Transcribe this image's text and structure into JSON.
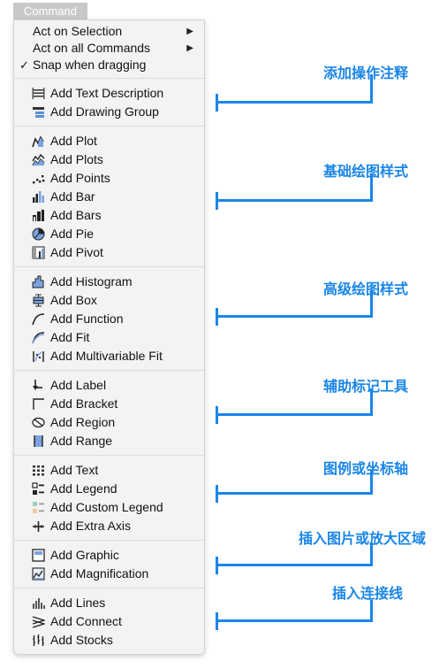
{
  "menu_title": "Command",
  "top_items": [
    {
      "label": "Act on Selection",
      "submenu": true,
      "checked": false
    },
    {
      "label": "Act on all Commands",
      "submenu": true,
      "checked": false
    },
    {
      "label": "Snap when dragging",
      "submenu": false,
      "checked": true
    }
  ],
  "check_glyph": "✓",
  "submenu_glyph": "▶",
  "groups": [
    {
      "items": [
        {
          "label": "Add Text Description",
          "icon": "text-description-icon"
        },
        {
          "label": "Add Drawing Group",
          "icon": "drawing-group-icon"
        }
      ]
    },
    {
      "items": [
        {
          "label": "Add Plot",
          "icon": "plot-icon"
        },
        {
          "label": "Add Plots",
          "icon": "plots-icon"
        },
        {
          "label": "Add Points",
          "icon": "points-icon"
        },
        {
          "label": "Add Bar",
          "icon": "bar-icon"
        },
        {
          "label": "Add Bars",
          "icon": "bars-icon"
        },
        {
          "label": "Add Pie",
          "icon": "pie-icon"
        },
        {
          "label": "Add Pivot",
          "icon": "pivot-icon"
        }
      ]
    },
    {
      "items": [
        {
          "label": "Add Histogram",
          "icon": "histogram-icon"
        },
        {
          "label": "Add Box",
          "icon": "box-icon"
        },
        {
          "label": "Add Function",
          "icon": "function-icon"
        },
        {
          "label": "Add Fit",
          "icon": "fit-icon"
        },
        {
          "label": "Add Multivariable Fit",
          "icon": "multivariable-fit-icon"
        }
      ]
    },
    {
      "items": [
        {
          "label": "Add Label",
          "icon": "label-icon"
        },
        {
          "label": "Add Bracket",
          "icon": "bracket-icon"
        },
        {
          "label": "Add Region",
          "icon": "region-icon"
        },
        {
          "label": "Add Range",
          "icon": "range-icon"
        }
      ]
    },
    {
      "items": [
        {
          "label": "Add Text",
          "icon": "text-icon"
        },
        {
          "label": "Add Legend",
          "icon": "legend-icon"
        },
        {
          "label": "Add Custom Legend",
          "icon": "custom-legend-icon"
        },
        {
          "label": "Add Extra Axis",
          "icon": "extra-axis-icon"
        }
      ]
    },
    {
      "items": [
        {
          "label": "Add Graphic",
          "icon": "graphic-icon"
        },
        {
          "label": "Add Magnification",
          "icon": "magnification-icon"
        }
      ]
    },
    {
      "items": [
        {
          "label": "Add Lines",
          "icon": "lines-icon"
        },
        {
          "label": "Add Connect",
          "icon": "connect-icon"
        },
        {
          "label": "Add Stocks",
          "icon": "stocks-icon"
        }
      ]
    }
  ],
  "annotations": [
    {
      "text": "添加操作注释"
    },
    {
      "text": "基础绘图样式"
    },
    {
      "text": "高级绘图样式"
    },
    {
      "text": "辅助标记工具"
    },
    {
      "text": "图例或坐标轴"
    },
    {
      "text": "插入图片或放大区域"
    },
    {
      "text": "插入连接线"
    }
  ],
  "colors": {
    "accent": "#1a86e8",
    "menu_bg": "#f3f3f3",
    "tab_bg": "#c9c9c9"
  }
}
